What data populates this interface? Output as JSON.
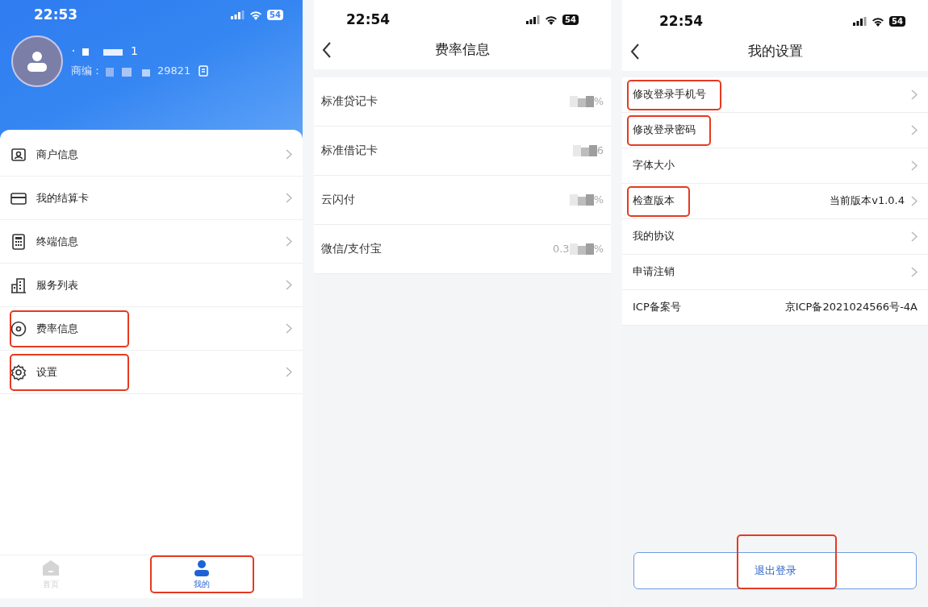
{
  "screens": [
    {
      "kind": "profile",
      "status_bar": {
        "time": "22:53",
        "battery": "54"
      },
      "profile": {
        "name_tail": "1",
        "merchant_label": "商编：",
        "merchant_tail": "29821"
      },
      "menu": [
        {
          "label": "商户信息",
          "highlighted": false
        },
        {
          "label": "我的结算卡",
          "highlighted": false
        },
        {
          "label": "终端信息",
          "highlighted": false
        },
        {
          "label": "服务列表",
          "highlighted": false
        },
        {
          "label": "费率信息",
          "highlighted": true
        },
        {
          "label": "设置",
          "highlighted": true
        }
      ],
      "tabs": [
        {
          "label": "首页",
          "selected": false,
          "highlighted": false
        },
        {
          "label": "我的",
          "selected": true,
          "highlighted": true
        }
      ]
    },
    {
      "kind": "rates",
      "status_bar": {
        "time": "22:54",
        "battery": "54"
      },
      "title": "费率信息",
      "rows": [
        {
          "label": "标准贷记卡",
          "value_start": "",
          "value_end": "%"
        },
        {
          "label": "标准借记卡",
          "value_start": "",
          "value_end": "6"
        },
        {
          "label": "云闪付",
          "value_start": "",
          "value_end": "%"
        },
        {
          "label": "微信/支付宝",
          "value_start": "0.3",
          "value_end": "%"
        }
      ]
    },
    {
      "kind": "settings",
      "status_bar": {
        "time": "22:54",
        "battery": "54"
      },
      "title": "我的设置",
      "rows": [
        {
          "kind": "link",
          "label": "修改登录手机号",
          "highlighted": true
        },
        {
          "kind": "link",
          "label": "修改登录密码",
          "highlighted": true
        },
        {
          "kind": "link",
          "label": "字体大小",
          "highlighted": false
        },
        {
          "kind": "link",
          "label": "检查版本",
          "value": "当前版本v1.0.4",
          "highlighted": true
        },
        {
          "kind": "link",
          "label": "我的协议",
          "highlighted": false
        },
        {
          "kind": "link",
          "label": "申请注销",
          "highlighted": false
        },
        {
          "kind": "info",
          "label": "ICP备案号",
          "value": "京ICP备2021024566号-4A",
          "highlighted": false
        }
      ],
      "logout": {
        "label": "退出登录",
        "highlighted": true
      }
    }
  ]
}
